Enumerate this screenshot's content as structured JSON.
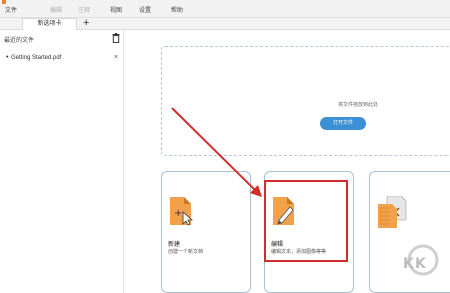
{
  "menu": {
    "items": [
      {
        "label": "文件",
        "enabled": true
      },
      {
        "label": "编辑",
        "enabled": false
      },
      {
        "label": "注释",
        "enabled": false
      },
      {
        "label": "视图",
        "enabled": true
      },
      {
        "label": "设置",
        "enabled": true
      },
      {
        "label": "帮助",
        "enabled": true
      }
    ]
  },
  "tabs": {
    "active_label": "新选项卡",
    "add_label": "+"
  },
  "sidebar": {
    "header": "最近的文件",
    "items": [
      {
        "label": "Getting Started.pdf",
        "close": "×"
      }
    ]
  },
  "dropzone": {
    "text": "将文件拖放到此处",
    "button_label": "打开文件",
    "button_color": "#3d8fd6"
  },
  "cards": [
    {
      "title": "新建",
      "description": "创建一个新文档",
      "icon": "new-document-icon"
    },
    {
      "title": "编辑",
      "description": "编辑文本，添加图像等等",
      "icon": "edit-document-icon"
    },
    {
      "title": "",
      "description": "",
      "icon": "convert-document-icon"
    }
  ],
  "annotation": {
    "highlight_color": "#d12d2d"
  },
  "colors": {
    "accent": "#3d8fd6",
    "card_border": "#a9c3d3",
    "icon_orange": "#f1a14a",
    "annotation_red": "#d12d2d"
  }
}
